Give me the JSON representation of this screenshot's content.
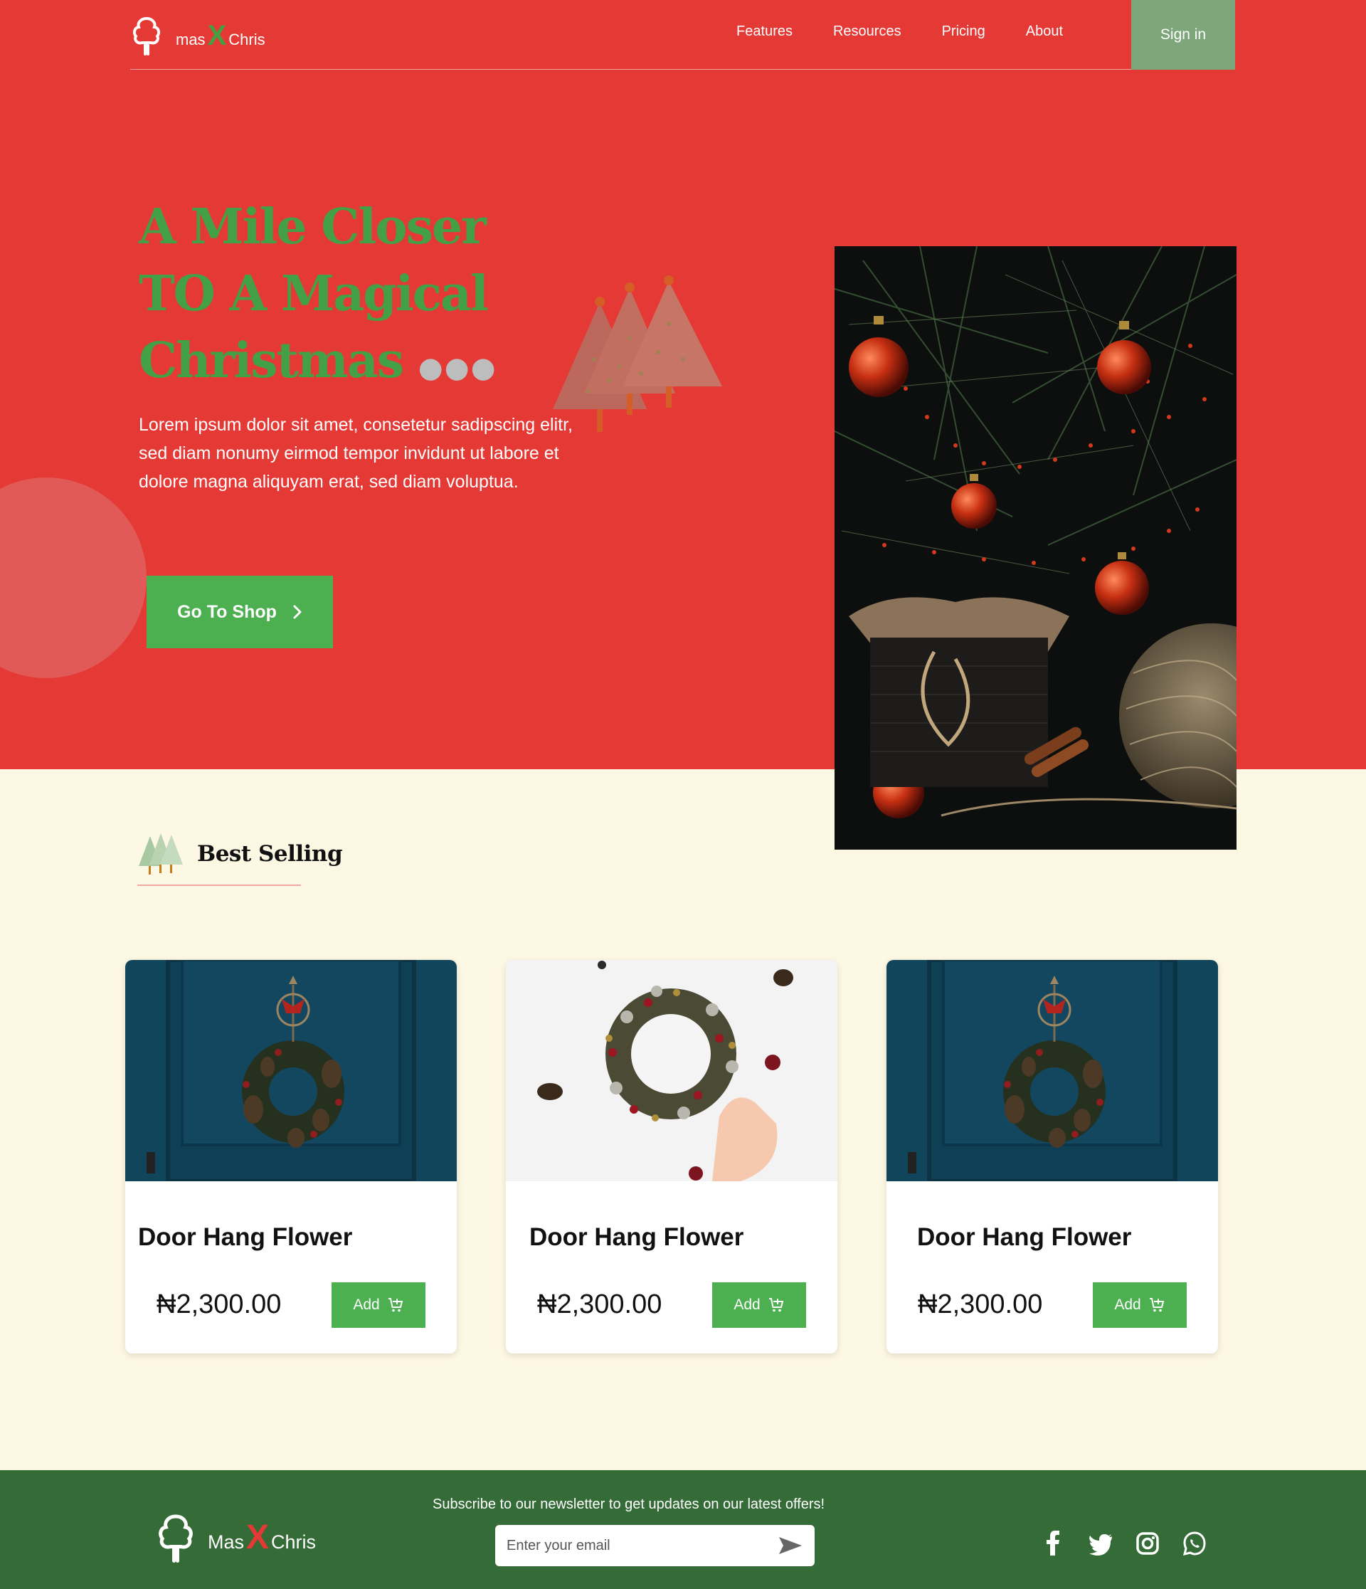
{
  "brand": {
    "name_left": "mas",
    "name_x": "X",
    "name_right": "Chris"
  },
  "nav": {
    "links": [
      "Features",
      "Resources",
      "Pricing",
      "About"
    ],
    "signin_label": "Sign in"
  },
  "hero": {
    "title_lines": [
      "A Mile Closer",
      "TO A Magical",
      "Christmas"
    ],
    "title_dots": "●●●",
    "description": "Lorem ipsum dolor sit amet, consetetur sadipscing elitr, sed diam nonumy eirmod tempor invidunt ut labore et dolore magna aliquyam erat, sed diam voluptua.",
    "cta_label": "Go To Shop"
  },
  "best_selling": {
    "title": "Best Selling",
    "products": [
      {
        "name": "Door Hang Flower",
        "price": "₦2,300.00",
        "add_label": "Add",
        "image": "wreath-on-blue-door"
      },
      {
        "name": "Door Hang Flower",
        "price": "₦2,300.00",
        "add_label": "Add",
        "image": "wreath-on-white-table"
      },
      {
        "name": "Door Hang Flower",
        "price": "₦2,300.00",
        "add_label": "Add",
        "image": "wreath-on-blue-door"
      }
    ]
  },
  "footer": {
    "brand": {
      "name_left": "Mas",
      "name_x": "X",
      "name_right": "Chris"
    },
    "newsletter_text": "Subscribe to our newsletter to get updates on our latest offers!",
    "email_placeholder": "Enter your email",
    "social": [
      "facebook-icon",
      "twitter-icon",
      "instagram-icon",
      "whatsapp-icon"
    ]
  },
  "colors": {
    "hero_red": "#e53935",
    "accent_green": "#4caf50",
    "title_green": "#43a047",
    "cream": "#fdf8e3",
    "footer_green": "#346b36",
    "signin_sage": "#7da77b"
  }
}
